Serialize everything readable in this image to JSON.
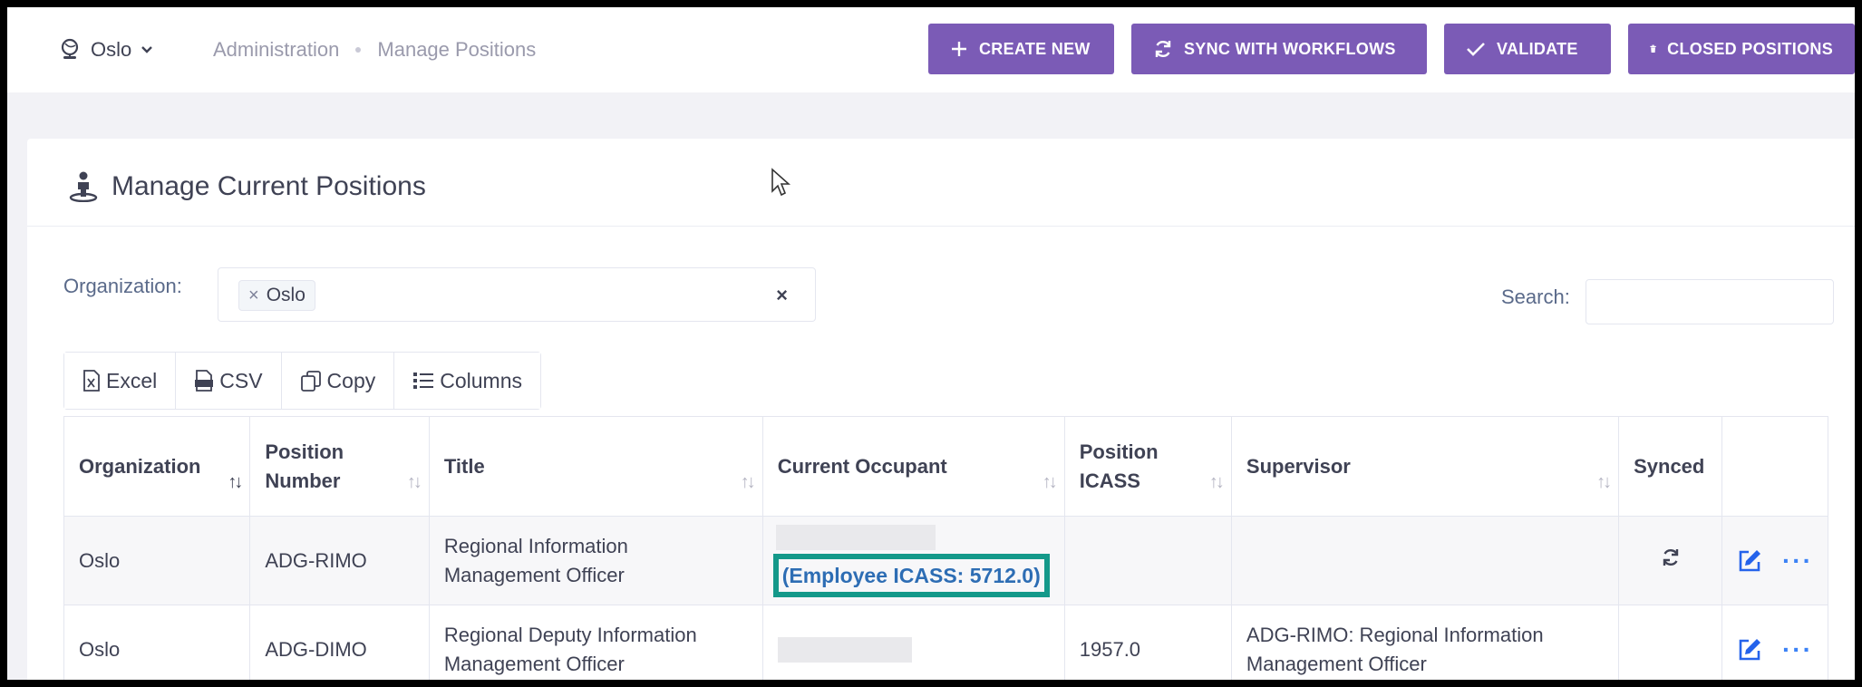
{
  "topbar": {
    "org_name": "Oslo",
    "breadcrumb": [
      "Administration",
      "Manage Positions"
    ],
    "actions": {
      "create_new": "CREATE NEW",
      "sync": "SYNC WITH WORKFLOWS",
      "validate": "VALIDATE",
      "closed": "CLOSED POSITIONS"
    }
  },
  "card": {
    "title": "Manage Current Positions"
  },
  "filters": {
    "org_label": "Organization:",
    "org_tag": "Oslo",
    "org_clear": "×",
    "search_label": "Search:",
    "search_value": ""
  },
  "export": {
    "excel": "Excel",
    "csv": "CSV",
    "copy": "Copy",
    "columns": "Columns"
  },
  "table": {
    "headers": {
      "organization": "Organization",
      "position_number_1": "Position",
      "position_number_2": "Number",
      "title": "Title",
      "current_occupant": "Current Occupant",
      "position_icass_1": "Position",
      "position_icass_2": "ICASS",
      "supervisor": "Supervisor",
      "synced": "Synced"
    },
    "rows": [
      {
        "organization": "Oslo",
        "position_number": "ADG-RIMO",
        "title_1": "Regional Information",
        "title_2": "Management Officer",
        "occupant_link": "(Employee ICASS: 5712.0)",
        "position_icass": "",
        "supervisor_1": "",
        "supervisor_2": ""
      },
      {
        "organization": "Oslo",
        "position_number": "ADG-DIMO",
        "title_1": "Regional Deputy Information",
        "title_2": "Management Officer",
        "occupant_link": "",
        "position_icass": "1957.0",
        "supervisor_1": "ADG-RIMO: Regional Information",
        "supervisor_2": "Management Officer"
      }
    ]
  },
  "colors": {
    "accent": "#7b5bb6",
    "highlight_border": "#14998a",
    "link": "#2d6db4",
    "edit_icon": "#2563eb"
  },
  "icons": {
    "org_switch": "globe-user-icon",
    "chevron": "chevron-down-icon",
    "create": "plus-icon",
    "sync": "sync-icon",
    "validate": "check-icon",
    "closed": "trash-icon",
    "card": "person-pin-icon",
    "excel": "excel-file-icon",
    "csv": "csv-file-icon",
    "copy": "copy-icon",
    "columns": "list-icon",
    "synced": "sync-icon",
    "edit": "edit-icon",
    "more": "more-icon"
  }
}
